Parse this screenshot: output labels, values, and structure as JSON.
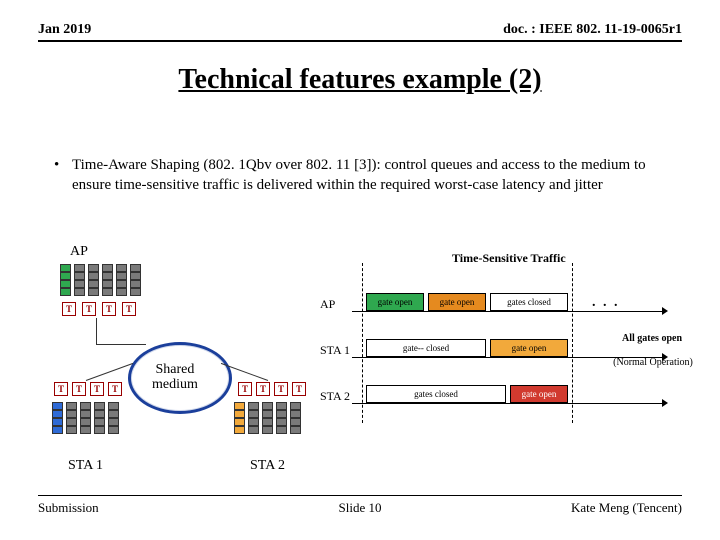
{
  "header": {
    "left": "Jan 2019",
    "right": "doc. : IEEE 802. 11-19-0065r1"
  },
  "title": "Technical features example (2)",
  "bullet_text": "Time-Aware Shaping (802. 1Qbv over 802. 11 [3]): control queues and access to the medium to ensure time-sensitive traffic is delivered within the required worst-case latency and jitter",
  "left_diagram": {
    "ap": "AP",
    "sta1": "STA 1",
    "sta2": "STA 2",
    "shared": "Shared\nmedium",
    "tbox": "T"
  },
  "right_diagram": {
    "top_label": "Time-Sensitive Traffic",
    "rows": [
      "AP",
      "STA 1",
      "STA 2"
    ],
    "boxes": {
      "gate_open": "gate open",
      "gate_closed": "gate-- closed",
      "gates_closed_top": "gates closed",
      "gates_closed_bot": "gates closed",
      "all_gates_open": "All gates open",
      "normal_op": "(Normal Operation)"
    },
    "dots": ". . ."
  },
  "footer": {
    "left": "Submission",
    "center": "Slide 10",
    "right": "Kate Meng (Tencent)"
  },
  "colors": {
    "green": "#2fa84f",
    "gray": "#7a7a7a",
    "blue": "#2f6bd6",
    "orange": "#f2a93b",
    "orange2": "#e58a1f",
    "red": "#d13a2f",
    "ellipse": "#1b3f9b"
  }
}
